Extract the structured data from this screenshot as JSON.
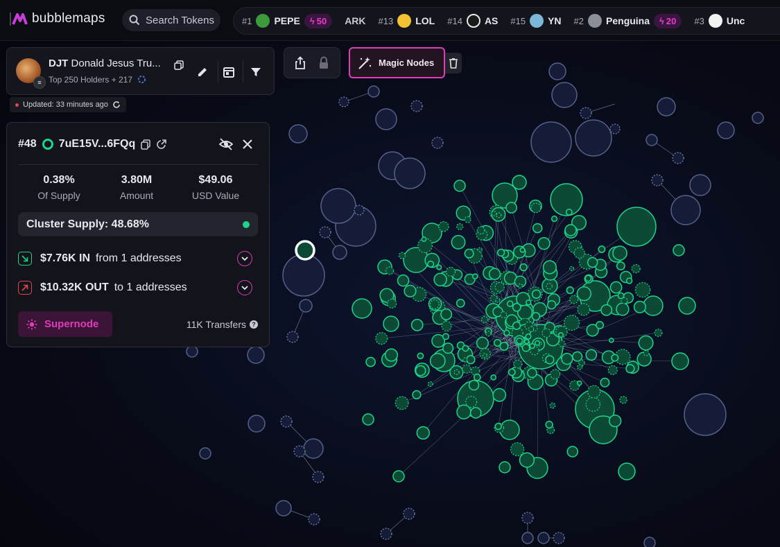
{
  "app": {
    "brand": "bubblemaps"
  },
  "search": {
    "label": "Search Tokens"
  },
  "ticker": [
    {
      "rank": "#1",
      "name": "PEPE",
      "boost": "50",
      "avatar_color": "#3c9a3a"
    },
    {
      "rank": "",
      "name": "ARK",
      "boost": "",
      "avatar_color": ""
    },
    {
      "rank": "#13",
      "name": "LOL",
      "boost": "",
      "avatar_color": "#f2c230"
    },
    {
      "rank": "#14",
      "name": "AS",
      "boost": "",
      "avatar_color": "#e9e9e9"
    },
    {
      "rank": "#15",
      "name": "YN",
      "boost": "",
      "avatar_color": "#7bb7d9"
    },
    {
      "rank": "#2",
      "name": "Penguina",
      "boost": "20",
      "avatar_color": "#8a8f99"
    },
    {
      "rank": "#3",
      "name": "Unc",
      "boost": "",
      "avatar_color": "#f2f2f2"
    }
  ],
  "token": {
    "symbol": "DJT",
    "name": "Donald Jesus Tru...",
    "holders": "Top 250 Holders + 217"
  },
  "status": {
    "updated": "Updated: 33 minutes ago"
  },
  "toolbar": {
    "magic_label": "Magic Nodes"
  },
  "details": {
    "rank": "#48",
    "address": "7uE15V...6FQq",
    "stats": [
      {
        "value": "0.38%",
        "label": "Of Supply"
      },
      {
        "value": "3.80M",
        "label": "Amount"
      },
      {
        "value": "$49.06",
        "label": "USD Value"
      }
    ],
    "cluster": "Cluster Supply: 48.68%",
    "flow_in": {
      "amount": "$7.76K IN",
      "desc": "from 1 addresses"
    },
    "flow_out": {
      "amount": "$10.32K OUT",
      "desc": "to 1 addresses"
    },
    "supernode_label": "Supernode",
    "transfers": "11K Transfers"
  },
  "colors": {
    "accent_pink": "#e23bb9",
    "node_green": "#1ed38a",
    "node_blue": "#1c2340",
    "background": "#07080f"
  }
}
